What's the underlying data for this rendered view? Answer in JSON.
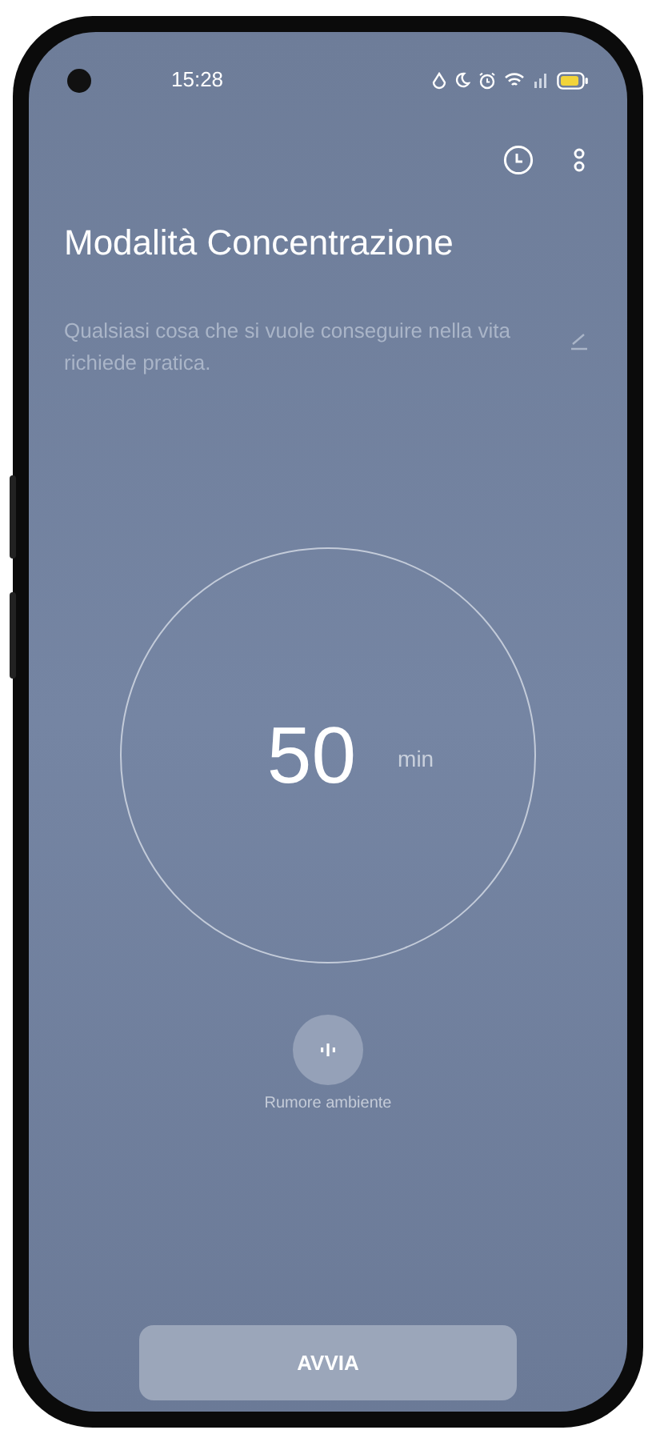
{
  "status_bar": {
    "time": "15:28"
  },
  "title": "Modalità Concentrazione",
  "quote": "Qualsiasi cosa che si vuole conseguire nella vita richiede pratica.",
  "timer": {
    "value": "50",
    "unit": "min"
  },
  "ambient_sound": {
    "label": "Rumore ambiente"
  },
  "start_button": {
    "label": "AVVIA"
  }
}
